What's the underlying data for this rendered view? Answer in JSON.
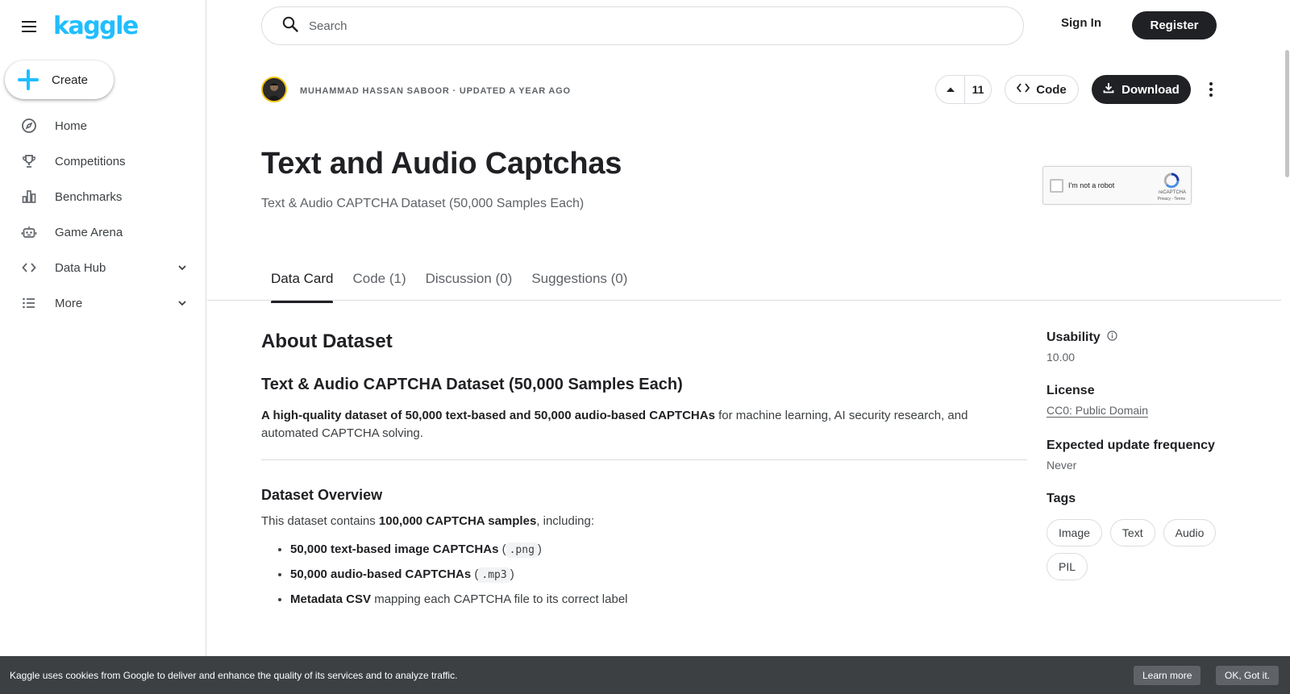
{
  "app": {
    "logo": "kaggle"
  },
  "sidebar": {
    "create_label": "Create",
    "items": [
      {
        "label": "Home",
        "icon": "compass-icon"
      },
      {
        "label": "Competitions",
        "icon": "trophy-icon"
      },
      {
        "label": "Benchmarks",
        "icon": "bar-chart-icon"
      },
      {
        "label": "Game Arena",
        "icon": "robot-icon"
      },
      {
        "label": "Data Hub",
        "icon": "code-icon"
      },
      {
        "label": "More",
        "icon": "list-icon"
      }
    ]
  },
  "topbar": {
    "search_placeholder": "Search",
    "signin": "Sign In",
    "register": "Register"
  },
  "dataset": {
    "meta": "MUHAMMAD HASSAN SABOOR · UPDATED A YEAR AGO",
    "votes": "11",
    "code_label": "Code",
    "download_label": "Download",
    "title": "Text and Audio Captchas",
    "subtitle": "Text & Audio CAPTCHA Dataset (50,000 Samples Each)"
  },
  "recaptcha": {
    "label": "I'm not a robot",
    "brand": "reCAPTCHA",
    "links": "Privacy - Terms"
  },
  "tabs": [
    {
      "label": "Data Card"
    },
    {
      "label": "Code (1)"
    },
    {
      "label": "Discussion (0)"
    },
    {
      "label": "Suggestions (0)"
    }
  ],
  "content": {
    "about": "About Dataset",
    "heading": "Text & Audio CAPTCHA Dataset (50,000 Samples Each)",
    "intro_icon": "",
    "intro_bold": "A high-quality dataset of 50,000 text-based and 50,000 audio-based CAPTCHAs",
    "intro_rest": " for machine learning, AI security research, and automated CAPTCHA solving.",
    "overview_icon": "",
    "overview_title": "Dataset Overview",
    "overview_pre": "This dataset contains ",
    "overview_bold": "100,000 CAPTCHA samples",
    "overview_post": ", including:",
    "bullets": [
      {
        "icon": "",
        "bold": "50,000 text-based image CAPTCHAs",
        "pre": " (",
        "code": ".png",
        "post": ")"
      },
      {
        "icon": "",
        "bold": "50,000 audio-based CAPTCHAs",
        "pre": " (",
        "code": ".mp3",
        "post": ")"
      },
      {
        "icon": "",
        "bold": "Metadata CSV",
        "pre": " mapping each CAPTCHA file to its correct label",
        "code": "",
        "post": ""
      }
    ]
  },
  "details": {
    "usability_label": "Usability",
    "usability_value": "10.00",
    "license_label": "License",
    "license_value": "CC0: Public Domain",
    "frequency_label": "Expected update frequency",
    "frequency_value": "Never",
    "tags_label": "Tags",
    "tags": [
      "Image",
      "Text",
      "Audio",
      "PIL"
    ]
  },
  "cookie": {
    "text": "Kaggle uses cookies from Google to deliver and enhance the quality of its services and to analyze traffic.",
    "learn_more": "Learn more",
    "ok": "OK, Got it."
  },
  "colors": {
    "brand": "#20beff",
    "text": "#202124",
    "muted": "#5f6368",
    "border": "#dadce0",
    "cookie_bg": "#3c4043"
  }
}
